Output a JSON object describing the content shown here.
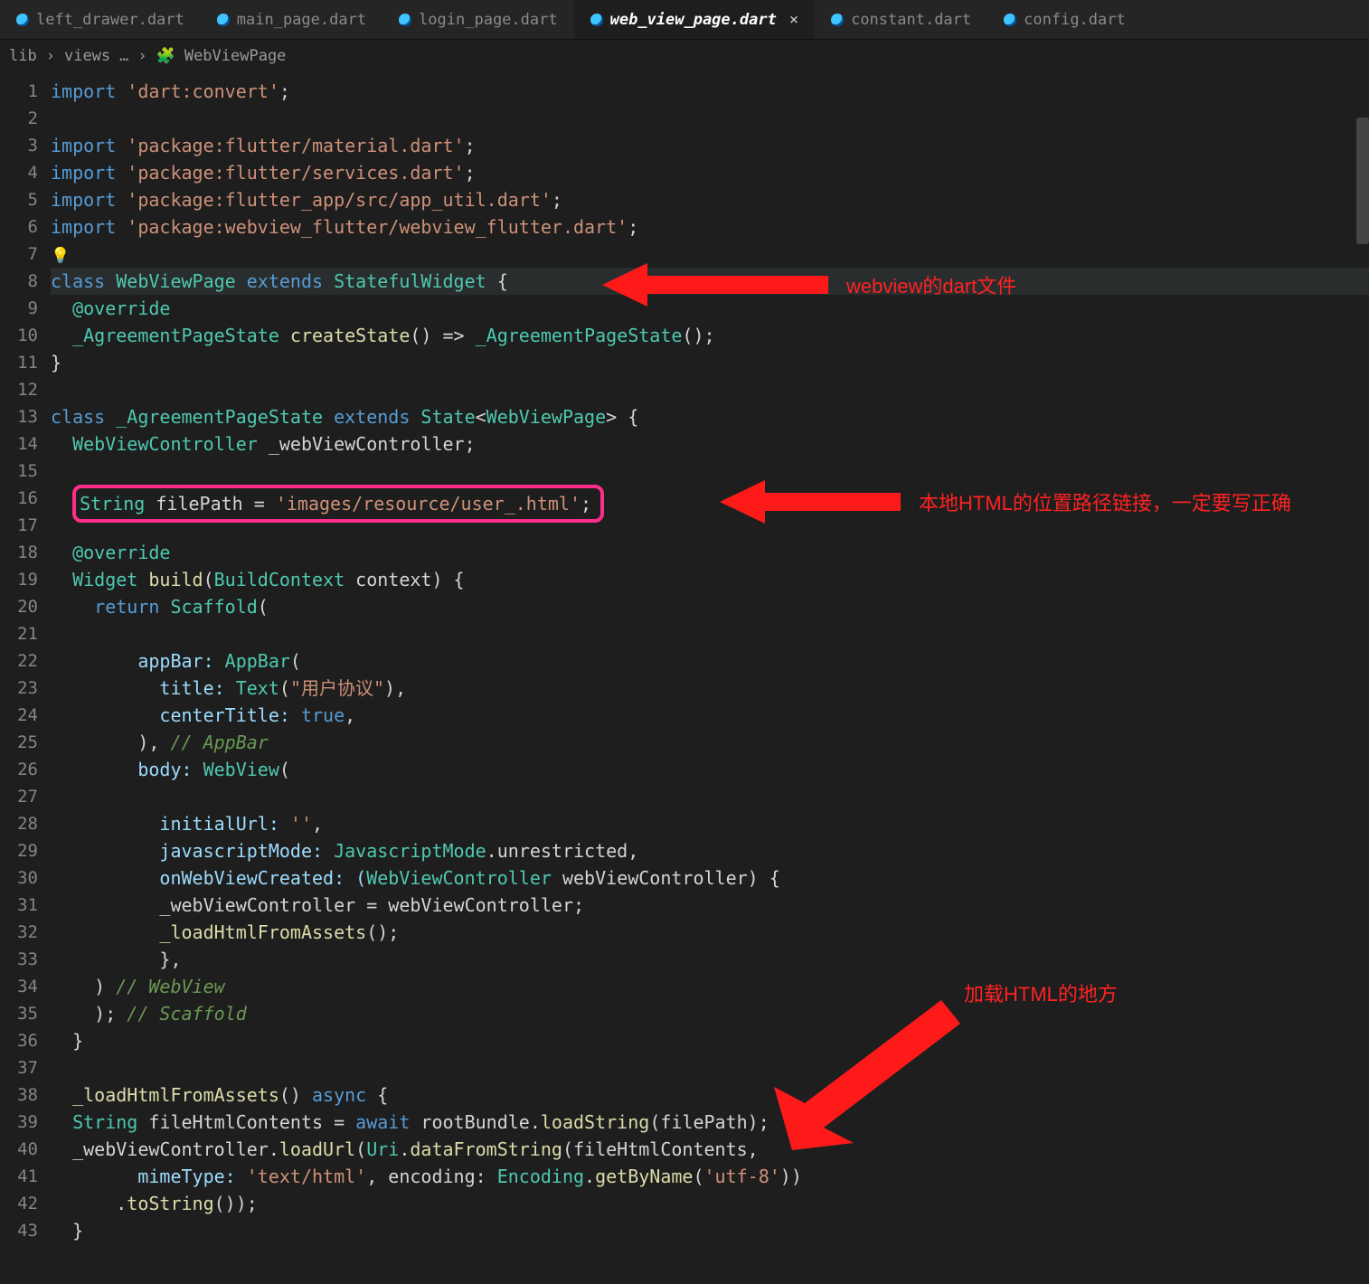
{
  "tabs": [
    {
      "label": "left_drawer.dart"
    },
    {
      "label": "main_page.dart"
    },
    {
      "label": "login_page.dart"
    },
    {
      "label": "web_view_page.dart",
      "active": true
    },
    {
      "label": "constant.dart"
    },
    {
      "label": "config.dart"
    }
  ],
  "active_close": "×",
  "crumbs": {
    "root": "lib",
    "sep": "›",
    "mid": "views",
    "dots": "…",
    "cls_ico": "🧩",
    "cls": "WebViewPage"
  },
  "lines": {
    "1": {
      "kw": "import",
      "str": "'dart:convert'",
      "semi": ";"
    },
    "2": {},
    "3": {
      "kw": "import",
      "str": "'package:flutter/material.dart'",
      "semi": ";"
    },
    "4": {
      "kw": "import",
      "str": "'package:flutter/services.dart'",
      "semi": ";"
    },
    "5": {
      "kw": "import",
      "str": "'package:flutter_app/src/app_util.dart'",
      "semi": ";"
    },
    "6": {
      "kw": "import",
      "str": "'package:webview_flutter/webview_flutter.dart'",
      "semi": ";"
    },
    "7": {
      "bulb": "💡"
    },
    "8": {
      "kw1": "class",
      "ty1": "WebViewPage",
      "kw2": "extends",
      "ty2": "StatefulWidget",
      "brace": " {"
    },
    "9": {
      "ann": "@override"
    },
    "10": {
      "ty": "_AgreementPageState",
      "fn": "createState",
      "mid": "() => ",
      "ty2": "_AgreementPageState",
      "tail": "();"
    },
    "11": {
      "txt": "}"
    },
    "12": {},
    "13": {
      "kw1": "class",
      "ty1": "_AgreementPageState",
      "kw2": "extends",
      "ty2": "State",
      "gen1": "<",
      "ty3": "WebViewPage",
      "gen2": ">",
      "brace": " {"
    },
    "14": {
      "ty": "WebViewController",
      "name": " _webViewController;"
    },
    "15": {},
    "16": {
      "ty": "String",
      "name": " filePath = ",
      "str": "'images/resource/user_.html'",
      "semi": ";"
    },
    "17": {},
    "18": {
      "ann": "@override"
    },
    "19": {
      "ty": "Widget",
      "fn": " build",
      "p": "(",
      "pty": "BuildContext",
      "pn": " context) {"
    },
    "20": {
      "kw": "return",
      "ty": " Scaffold",
      "tail": "("
    },
    "21": {},
    "22": {
      "lbl": "appBar: ",
      "ty": "AppBar",
      "tail": "("
    },
    "23": {
      "lbl": "title: ",
      "ty": "Text",
      "p": "(",
      "str": "\"用户协议\"",
      "tail": "),"
    },
    "24": {
      "lbl": "centerTitle: ",
      "val": "true",
      "tail": ","
    },
    "25": {
      "txt": "), ",
      "c": "// AppBar"
    },
    "26": {
      "lbl": "body: ",
      "ty": "WebView",
      "tail": "("
    },
    "27": {},
    "28": {
      "lbl": "initialUrl: ",
      "str": "''",
      "tail": ","
    },
    "29": {
      "lbl": "javascriptMode: ",
      "ty": "JavascriptMode",
      "mem": ".unrestricted,"
    },
    "30": {
      "lbl": "onWebViewCreated: (",
      "ty": "WebViewController",
      "pn": " webViewController) {"
    },
    "31": {
      "txt": "_webViewController = webViewController;"
    },
    "32": {
      "fn": "_loadHtmlFromAssets",
      "tail": "();"
    },
    "33": {
      "txt": "},"
    },
    "34": {
      "txt": ") ",
      "c": "// WebView"
    },
    "35": {
      "txt": "); ",
      "c": "// Scaffold"
    },
    "36": {
      "txt": "}"
    },
    "37": {},
    "38": {
      "fn": "_loadHtmlFromAssets",
      "p": "() ",
      "kw": "async",
      "brace": " {"
    },
    "39": {
      "ty": "String",
      "name": " fileHtmlContents = ",
      "kw": "await",
      "obj": " rootBundle.",
      "fn": "loadString",
      "tail": "(filePath);"
    },
    "40": {
      "txt": "_webViewController.",
      "fn": "loadUrl",
      "p": "(",
      "ty": "Uri",
      "mem": ".",
      "fn2": "dataFromString",
      "tail": "(fileHtmlContents,"
    },
    "41": {
      "lbl": "mimeType: ",
      "str": "'text/html'",
      "mid": ", encoding: ",
      "ty": "Encoding",
      "mem": ".",
      "fn": "getByName",
      "p": "(",
      "str2": "'utf-8'",
      "tail": "))"
    },
    "42": {
      "mem": ".",
      "fn": "toString",
      "tail": "());"
    },
    "43": {
      "txt": "}"
    }
  },
  "callouts": {
    "a": "webview的dart文件",
    "b": "本地HTML的位置路径链接，一定要写正确",
    "c": "加载HTML的地方"
  }
}
